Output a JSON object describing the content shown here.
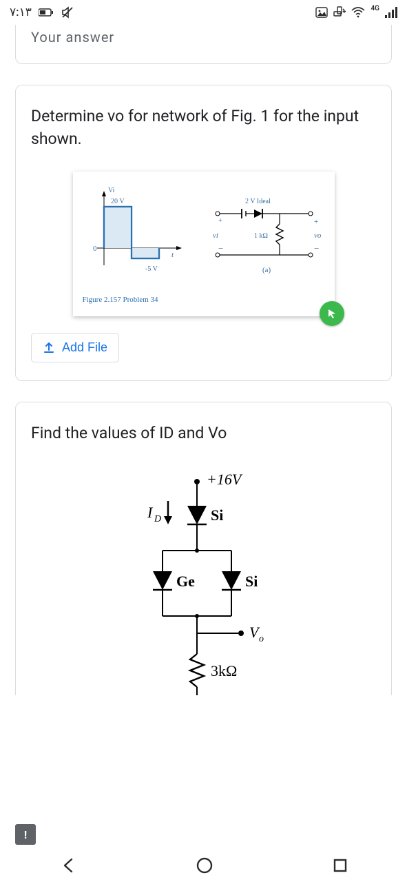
{
  "status": {
    "time": "٧:١٣",
    "network_label": "4G"
  },
  "partial_card": {
    "text": "Your answer"
  },
  "q1": {
    "prompt": "Determine vo for network of Fig. 1 for the input shown.",
    "fig": {
      "vi_label": "Vi",
      "top_v": "20 V",
      "bottom_v": "-5 V",
      "zero": "0",
      "t": "t",
      "ideal": "2 V  Ideal",
      "vi2": "vi",
      "r": "1 kΩ",
      "plus": "+",
      "minus": "−",
      "vo": "vo",
      "sub": "(a)",
      "caption": "Figure 2.157   Problem 34"
    },
    "add_file": "Add File"
  },
  "q2": {
    "prompt": "Find the values of ID and Vo",
    "fig": {
      "supply": "+16V",
      "id": "I",
      "id_sub": "D",
      "si": "Si",
      "ge": "Ge",
      "si2": "Si",
      "vo": "V",
      "vo_sub": "o",
      "r": "3kΩ"
    }
  },
  "alert": "!"
}
